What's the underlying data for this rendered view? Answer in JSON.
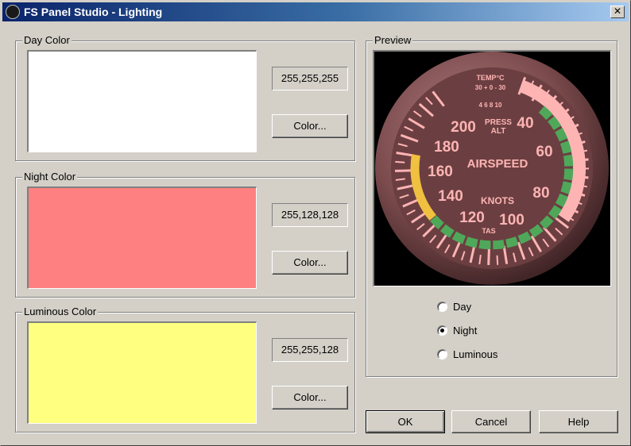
{
  "window": {
    "title": "FS Panel Studio - Lighting",
    "close_glyph": "✕"
  },
  "groups": {
    "day": {
      "label": "Day Color",
      "value": "255,255,255",
      "color": "#ffffff",
      "button": "Color..."
    },
    "night": {
      "label": "Night Color",
      "value": "255,128,128",
      "color": "#ff8080",
      "button": "Color..."
    },
    "luminous": {
      "label": "Luminous Color",
      "value": "255,255,128",
      "color": "#ffff80",
      "button": "Color..."
    }
  },
  "preview": {
    "label": "Preview",
    "gauge": {
      "temp_label": "TEMP°C",
      "temp_scale": "30 + 0 - 30",
      "alt_digits": "4 6 8 10",
      "press_label": "PRESS",
      "alt_label": "ALT",
      "title": "AIRSPEED",
      "unit": "KNOTS",
      "tas_label": "TAS",
      "numbers": [
        "40",
        "60",
        "80",
        "100",
        "120",
        "140",
        "160",
        "180",
        "200"
      ]
    },
    "options": [
      {
        "label": "Day",
        "checked": false
      },
      {
        "label": "Night",
        "checked": true
      },
      {
        "label": "Luminous",
        "checked": false
      }
    ]
  },
  "buttons": {
    "ok": "OK",
    "cancel": "Cancel",
    "help": "Help"
  },
  "colors": {
    "gauge_face": "#6b3f41",
    "gauge_markings": "#ffb4b4",
    "green_arc": "#4fa85a",
    "yellow_arc": "#f0c040"
  }
}
